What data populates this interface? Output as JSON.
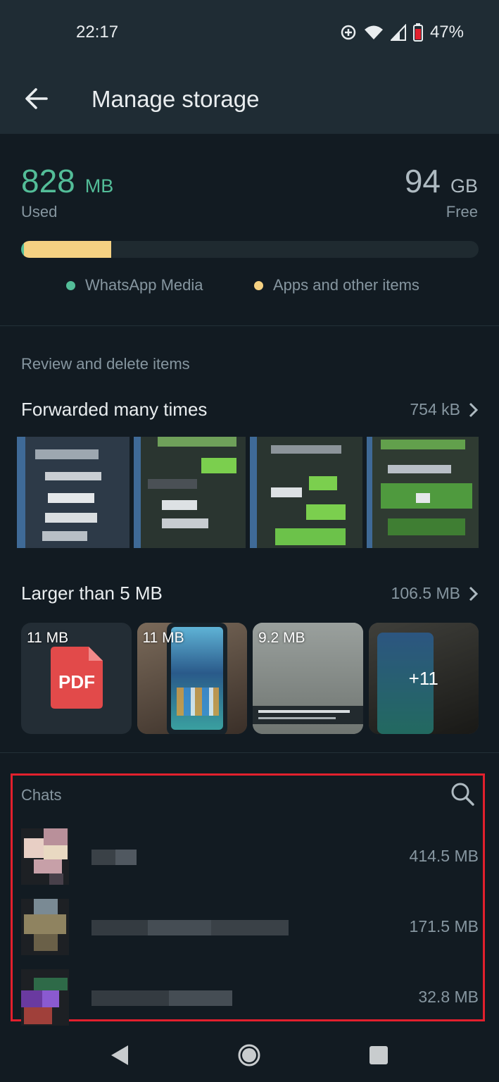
{
  "status_bar": {
    "time": "22:17",
    "battery": "47%",
    "icons": [
      "data-saver-icon",
      "wifi-icon",
      "signal-icon",
      "battery-icon"
    ]
  },
  "app_bar": {
    "title": "Manage storage",
    "back_icon": "arrow-back-icon"
  },
  "storage": {
    "used_value": "828",
    "used_unit": "MB",
    "used_label": "Used",
    "free_value": "94",
    "free_unit": "GB",
    "free_label": "Free",
    "whatsapp_media_fraction": 0.005,
    "apps_other_fraction": 0.19,
    "legend": [
      {
        "label": "WhatsApp Media",
        "color": "#53bd98"
      },
      {
        "label": "Apps and other items",
        "color": "#f5d182"
      }
    ]
  },
  "review": {
    "section_label": "Review and delete items",
    "forwarded": {
      "title": "Forwarded many times",
      "size": "754 kB"
    },
    "larger": {
      "title": "Larger than 5 MB",
      "size": "106.5 MB",
      "items": [
        {
          "label": "11 MB",
          "kind": "pdf",
          "badge": "PDF"
        },
        {
          "label": "11 MB",
          "kind": "photo"
        },
        {
          "label": "9.2 MB",
          "kind": "screenshot"
        },
        {
          "label": "",
          "kind": "photo",
          "overlay": "+11"
        }
      ]
    }
  },
  "chats": {
    "section_label": "Chats",
    "search_icon": "search-icon",
    "items": [
      {
        "size": "414.5 MB"
      },
      {
        "size": "171.5 MB"
      },
      {
        "size": "32.8 MB"
      }
    ]
  },
  "nav_bar": {
    "icons": [
      "back-triangle-icon",
      "home-circle-icon",
      "recents-square-icon"
    ]
  },
  "colors": {
    "accent": "#53bd98",
    "apps": "#f5d182",
    "highlight": "#e2202d",
    "background": "#121b22",
    "header": "#1f2c34"
  }
}
